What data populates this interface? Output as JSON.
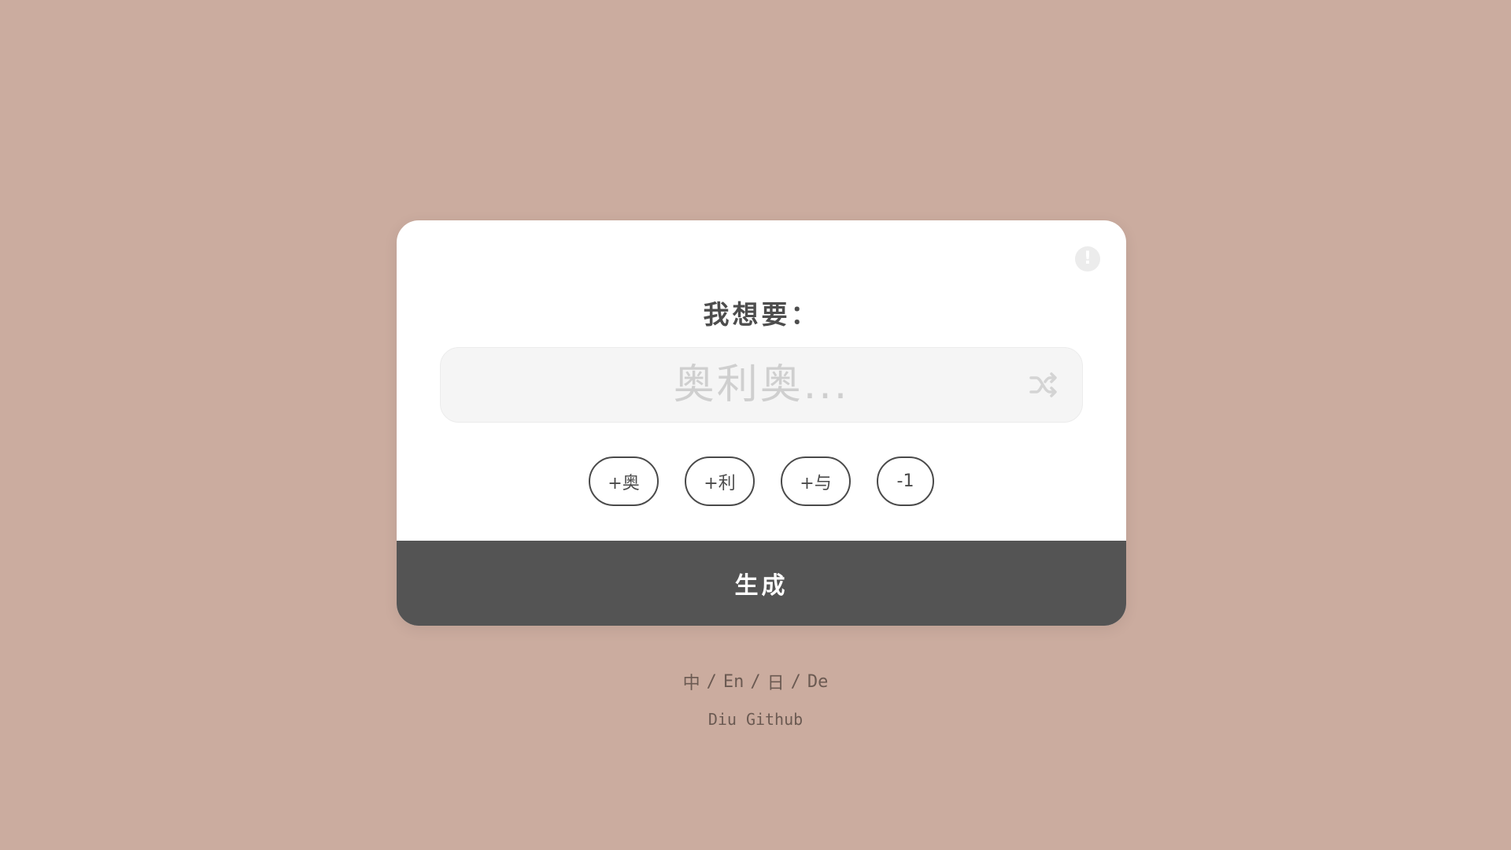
{
  "card": {
    "info_icon": "!",
    "prompt": "我想要：",
    "input": {
      "value": "",
      "placeholder": "奥利奥..."
    },
    "shuffle_icon": "shuffle-icon",
    "chips": [
      {
        "label": "+奥"
      },
      {
        "label": "+利"
      },
      {
        "label": "+与"
      },
      {
        "label": "-1"
      }
    ],
    "generate_label": "生成"
  },
  "footer": {
    "languages": [
      "中",
      "En",
      "日",
      "De"
    ],
    "separator": "/",
    "credits": [
      "Diu",
      "Github"
    ]
  },
  "colors": {
    "background": "#cbac9f",
    "card": "#ffffff",
    "button": "#545454",
    "text": "#545454"
  }
}
